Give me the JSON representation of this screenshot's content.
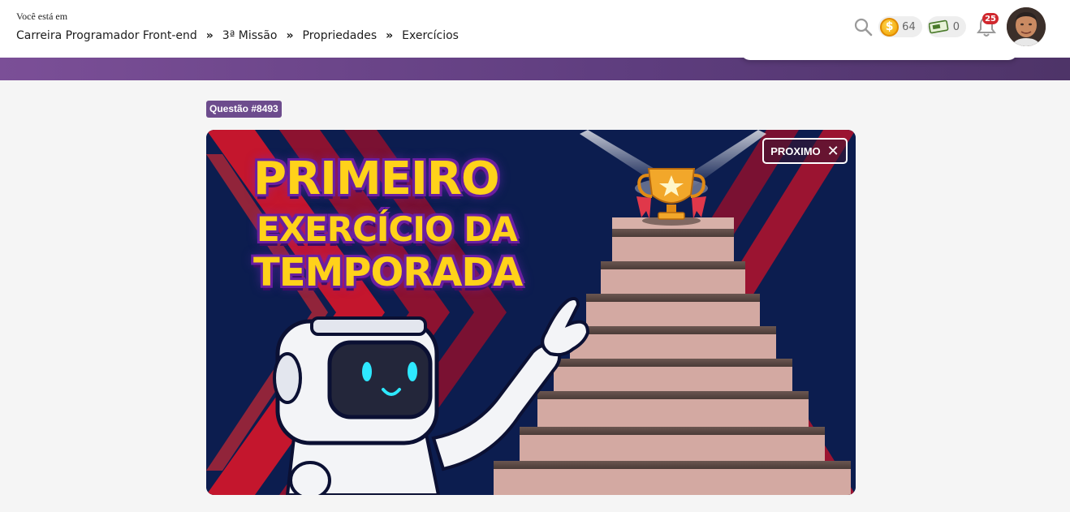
{
  "header": {
    "location_label": "Você está em",
    "breadcrumb": [
      {
        "label": "Carreira Programador Front-end"
      },
      {
        "label": "3ª Missão"
      },
      {
        "label": "Propriedades"
      },
      {
        "label": "Exercícios"
      }
    ],
    "separator": "»",
    "coins": {
      "icon": "coin-icon",
      "value": "64",
      "symbol": "$"
    },
    "tickets": {
      "icon": "ticket-icon",
      "value": "0"
    },
    "notifications": {
      "icon": "bell-icon",
      "count": "25"
    },
    "avatar": {
      "icon": "user-avatar"
    }
  },
  "question": {
    "label": "Questão #8493"
  },
  "banner": {
    "title_line_1": "PRIMEIRO",
    "title_line_2": "EXERCÍCIO DA",
    "title_line_3": "TEMPORADA",
    "next_button_label": "PROXIMO",
    "close_symbol": "✕"
  },
  "colors": {
    "accent_purple": "#6d4c8d",
    "banner_bg": "#0c1d4f",
    "title_yellow": "#ffd21a",
    "badge_red": "#d0282e"
  }
}
